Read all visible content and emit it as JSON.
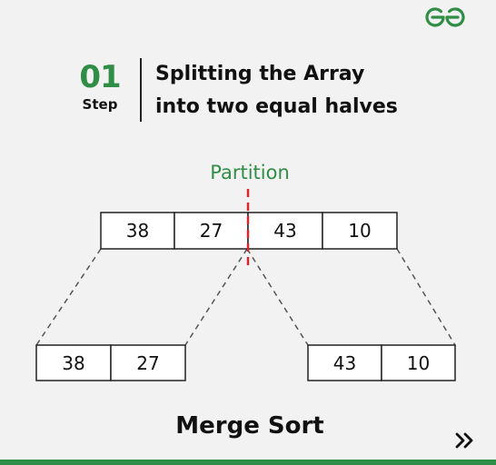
{
  "brand": {
    "logo_icon": "gfg-logo-icon",
    "color": "#2f8d46"
  },
  "step": {
    "number": "01",
    "word": "Step"
  },
  "title": {
    "line1": "Splitting the Array",
    "line2": "into two equal halves"
  },
  "partition_label": "Partition",
  "arrays": {
    "original": [
      "38",
      "27",
      "43",
      "10"
    ],
    "left_half": [
      "38",
      "27"
    ],
    "right_half": [
      "43",
      "10"
    ]
  },
  "caption": "Merge Sort",
  "nav": {
    "next_icon": "double-chevron-right-icon"
  },
  "colors": {
    "accent": "#2f8d46",
    "partition_line": "#d62828",
    "background": "#f2f2f2"
  }
}
